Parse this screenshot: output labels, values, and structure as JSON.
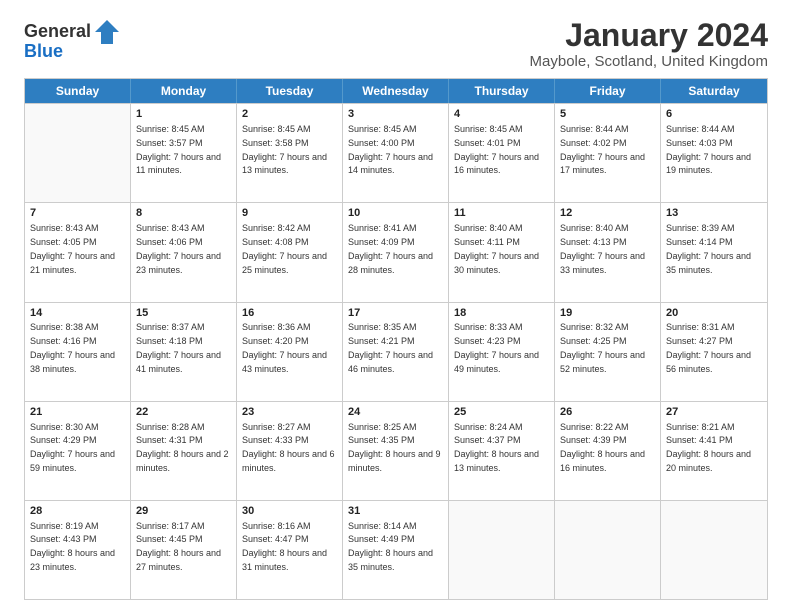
{
  "header": {
    "logo_general": "General",
    "logo_blue": "Blue",
    "title": "January 2024",
    "location": "Maybole, Scotland, United Kingdom"
  },
  "days_of_week": [
    "Sunday",
    "Monday",
    "Tuesday",
    "Wednesday",
    "Thursday",
    "Friday",
    "Saturday"
  ],
  "weeks": [
    [
      {
        "day": "",
        "sunrise": "",
        "sunset": "",
        "daylight": "",
        "empty": true
      },
      {
        "day": "1",
        "sunrise": "Sunrise: 8:45 AM",
        "sunset": "Sunset: 3:57 PM",
        "daylight": "Daylight: 7 hours and 11 minutes."
      },
      {
        "day": "2",
        "sunrise": "Sunrise: 8:45 AM",
        "sunset": "Sunset: 3:58 PM",
        "daylight": "Daylight: 7 hours and 13 minutes."
      },
      {
        "day": "3",
        "sunrise": "Sunrise: 8:45 AM",
        "sunset": "Sunset: 4:00 PM",
        "daylight": "Daylight: 7 hours and 14 minutes."
      },
      {
        "day": "4",
        "sunrise": "Sunrise: 8:45 AM",
        "sunset": "Sunset: 4:01 PM",
        "daylight": "Daylight: 7 hours and 16 minutes."
      },
      {
        "day": "5",
        "sunrise": "Sunrise: 8:44 AM",
        "sunset": "Sunset: 4:02 PM",
        "daylight": "Daylight: 7 hours and 17 minutes."
      },
      {
        "day": "6",
        "sunrise": "Sunrise: 8:44 AM",
        "sunset": "Sunset: 4:03 PM",
        "daylight": "Daylight: 7 hours and 19 minutes."
      }
    ],
    [
      {
        "day": "7",
        "sunrise": "Sunrise: 8:43 AM",
        "sunset": "Sunset: 4:05 PM",
        "daylight": "Daylight: 7 hours and 21 minutes."
      },
      {
        "day": "8",
        "sunrise": "Sunrise: 8:43 AM",
        "sunset": "Sunset: 4:06 PM",
        "daylight": "Daylight: 7 hours and 23 minutes."
      },
      {
        "day": "9",
        "sunrise": "Sunrise: 8:42 AM",
        "sunset": "Sunset: 4:08 PM",
        "daylight": "Daylight: 7 hours and 25 minutes."
      },
      {
        "day": "10",
        "sunrise": "Sunrise: 8:41 AM",
        "sunset": "Sunset: 4:09 PM",
        "daylight": "Daylight: 7 hours and 28 minutes."
      },
      {
        "day": "11",
        "sunrise": "Sunrise: 8:40 AM",
        "sunset": "Sunset: 4:11 PM",
        "daylight": "Daylight: 7 hours and 30 minutes."
      },
      {
        "day": "12",
        "sunrise": "Sunrise: 8:40 AM",
        "sunset": "Sunset: 4:13 PM",
        "daylight": "Daylight: 7 hours and 33 minutes."
      },
      {
        "day": "13",
        "sunrise": "Sunrise: 8:39 AM",
        "sunset": "Sunset: 4:14 PM",
        "daylight": "Daylight: 7 hours and 35 minutes."
      }
    ],
    [
      {
        "day": "14",
        "sunrise": "Sunrise: 8:38 AM",
        "sunset": "Sunset: 4:16 PM",
        "daylight": "Daylight: 7 hours and 38 minutes."
      },
      {
        "day": "15",
        "sunrise": "Sunrise: 8:37 AM",
        "sunset": "Sunset: 4:18 PM",
        "daylight": "Daylight: 7 hours and 41 minutes."
      },
      {
        "day": "16",
        "sunrise": "Sunrise: 8:36 AM",
        "sunset": "Sunset: 4:20 PM",
        "daylight": "Daylight: 7 hours and 43 minutes."
      },
      {
        "day": "17",
        "sunrise": "Sunrise: 8:35 AM",
        "sunset": "Sunset: 4:21 PM",
        "daylight": "Daylight: 7 hours and 46 minutes."
      },
      {
        "day": "18",
        "sunrise": "Sunrise: 8:33 AM",
        "sunset": "Sunset: 4:23 PM",
        "daylight": "Daylight: 7 hours and 49 minutes."
      },
      {
        "day": "19",
        "sunrise": "Sunrise: 8:32 AM",
        "sunset": "Sunset: 4:25 PM",
        "daylight": "Daylight: 7 hours and 52 minutes."
      },
      {
        "day": "20",
        "sunrise": "Sunrise: 8:31 AM",
        "sunset": "Sunset: 4:27 PM",
        "daylight": "Daylight: 7 hours and 56 minutes."
      }
    ],
    [
      {
        "day": "21",
        "sunrise": "Sunrise: 8:30 AM",
        "sunset": "Sunset: 4:29 PM",
        "daylight": "Daylight: 7 hours and 59 minutes."
      },
      {
        "day": "22",
        "sunrise": "Sunrise: 8:28 AM",
        "sunset": "Sunset: 4:31 PM",
        "daylight": "Daylight: 8 hours and 2 minutes."
      },
      {
        "day": "23",
        "sunrise": "Sunrise: 8:27 AM",
        "sunset": "Sunset: 4:33 PM",
        "daylight": "Daylight: 8 hours and 6 minutes."
      },
      {
        "day": "24",
        "sunrise": "Sunrise: 8:25 AM",
        "sunset": "Sunset: 4:35 PM",
        "daylight": "Daylight: 8 hours and 9 minutes."
      },
      {
        "day": "25",
        "sunrise": "Sunrise: 8:24 AM",
        "sunset": "Sunset: 4:37 PM",
        "daylight": "Daylight: 8 hours and 13 minutes."
      },
      {
        "day": "26",
        "sunrise": "Sunrise: 8:22 AM",
        "sunset": "Sunset: 4:39 PM",
        "daylight": "Daylight: 8 hours and 16 minutes."
      },
      {
        "day": "27",
        "sunrise": "Sunrise: 8:21 AM",
        "sunset": "Sunset: 4:41 PM",
        "daylight": "Daylight: 8 hours and 20 minutes."
      }
    ],
    [
      {
        "day": "28",
        "sunrise": "Sunrise: 8:19 AM",
        "sunset": "Sunset: 4:43 PM",
        "daylight": "Daylight: 8 hours and 23 minutes."
      },
      {
        "day": "29",
        "sunrise": "Sunrise: 8:17 AM",
        "sunset": "Sunset: 4:45 PM",
        "daylight": "Daylight: 8 hours and 27 minutes."
      },
      {
        "day": "30",
        "sunrise": "Sunrise: 8:16 AM",
        "sunset": "Sunset: 4:47 PM",
        "daylight": "Daylight: 8 hours and 31 minutes."
      },
      {
        "day": "31",
        "sunrise": "Sunrise: 8:14 AM",
        "sunset": "Sunset: 4:49 PM",
        "daylight": "Daylight: 8 hours and 35 minutes."
      },
      {
        "day": "",
        "sunrise": "",
        "sunset": "",
        "daylight": "",
        "empty": true
      },
      {
        "day": "",
        "sunrise": "",
        "sunset": "",
        "daylight": "",
        "empty": true
      },
      {
        "day": "",
        "sunrise": "",
        "sunset": "",
        "daylight": "",
        "empty": true
      }
    ]
  ]
}
